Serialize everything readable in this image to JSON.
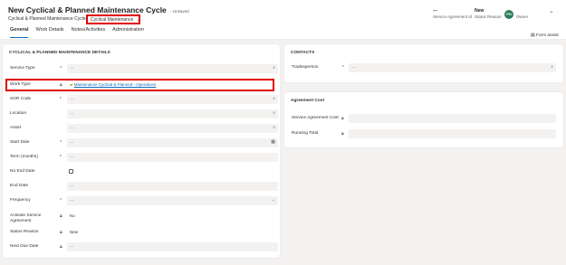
{
  "header": {
    "title": "New Cyclical & Planned Maintenance Cycle",
    "saved_state": "- Unsaved",
    "entity": "Cyclical & Planned Maintenance Cycle",
    "form_name": "Cyclical Maintenance",
    "fields": [
      {
        "value": "---",
        "label": "Service Agreement Id"
      },
      {
        "value": "New",
        "label": "Status Reason"
      }
    ],
    "owner_initials": "PH",
    "owner_label": "Owner"
  },
  "tabs": [
    "General",
    "Work Details",
    "Notes/Activities",
    "Administration"
  ],
  "form_assist": "Form assist",
  "details": {
    "title": "CYCLICAL & PLANNED MAINTENANCE DETAILS",
    "rows": [
      {
        "label": "Service Type",
        "value": "---"
      },
      {
        "label": "Work Type",
        "value": "Maintenance Cyclical & Planned - Operations"
      },
      {
        "label": "SOR Code",
        "value": "---"
      },
      {
        "label": "Location",
        "value": "---"
      },
      {
        "label": "Asset",
        "value": "---"
      },
      {
        "label": "Start Date",
        "value": "---"
      },
      {
        "label": "Term (months)",
        "value": "---"
      },
      {
        "label": "No End Date",
        "value": ""
      },
      {
        "label": "End Date",
        "value": "---"
      },
      {
        "label": "Frequency",
        "value": "---"
      },
      {
        "label": "Activate Service Agreement",
        "value": "No"
      },
      {
        "label": "Status Reason",
        "value": "New"
      },
      {
        "label": "Next Due Date",
        "value": "---"
      }
    ]
  },
  "contacts": {
    "title": "CONTACTS",
    "rows": [
      {
        "label": "Tradesperson",
        "value": "---"
      }
    ]
  },
  "agreement_cost": {
    "title": "Agreement Cost",
    "rows": [
      {
        "label": "Service Agreement Cost",
        "value": ""
      },
      {
        "label": "Running Total",
        "value": ""
      }
    ]
  },
  "icons": {
    "required": "required-asterisk",
    "locked": "lock-icon",
    "search": "search-icon",
    "calendar": "calendar-icon",
    "dropdown": "chevron-down-icon",
    "lookup": "folder-lookup-icon",
    "form_assist": "form-assist-icon"
  },
  "colors": {
    "accent": "#0f6cbd",
    "highlight": "#e00000",
    "owner_avatar": "#2e7d5b"
  }
}
